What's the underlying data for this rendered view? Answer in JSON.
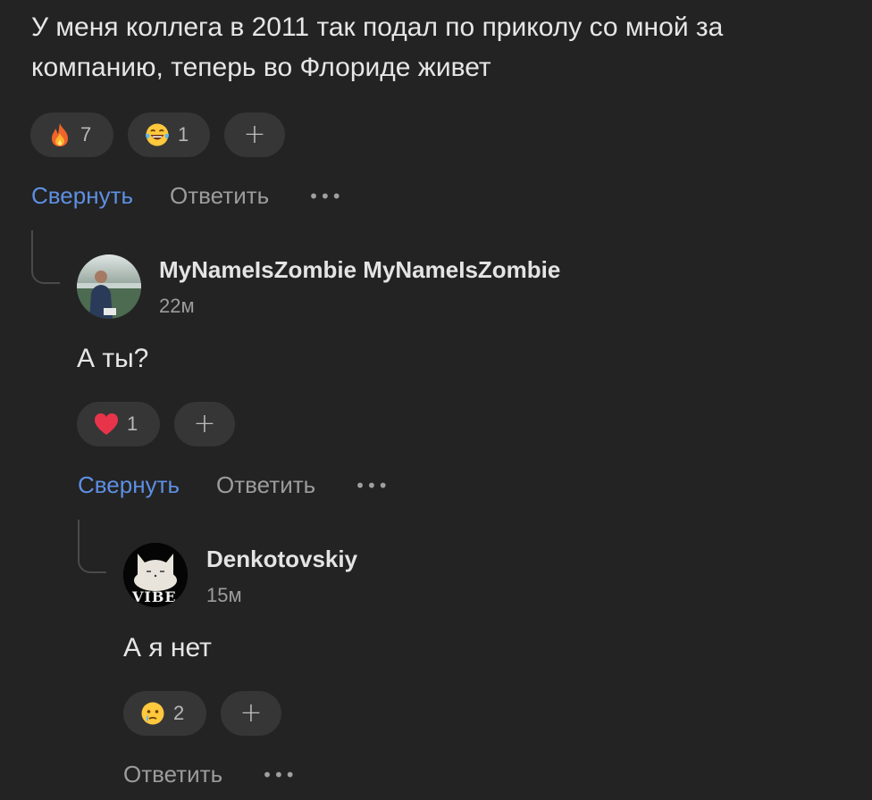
{
  "root_comment": {
    "text": "У меня коллега в 2011 так подал по приколу со мной за компанию, теперь во Флориде живет",
    "reactions": [
      {
        "icon": "fire-emoji-icon",
        "count": "7"
      },
      {
        "icon": "laughing-tears-emoji-icon",
        "count": "1"
      }
    ],
    "add_reaction": "+",
    "collapse_label": "Свернуть",
    "reply_label": "Ответить",
    "more_label": "•••"
  },
  "reply1": {
    "author": "MyNameIsZombie MyNameIsZombie",
    "time": "22м",
    "text": "А ты?",
    "reactions": [
      {
        "icon": "red-heart-emoji-icon",
        "count": "1"
      }
    ],
    "add_reaction": "+",
    "collapse_label": "Свернуть",
    "reply_label": "Ответить",
    "more_label": "•••"
  },
  "reply2": {
    "author": "Denkotovskiy",
    "time": "15м",
    "avatar_caption": "VIBE",
    "text": "А я нет",
    "reactions": [
      {
        "icon": "crying-face-emoji-icon",
        "count": "2"
      }
    ],
    "add_reaction": "+",
    "reply_label": "Ответить",
    "more_label": "•••"
  },
  "colors": {
    "background": "#232323",
    "chip": "#363636",
    "link": "#5e8fe3",
    "muted": "#9c9c9c"
  }
}
